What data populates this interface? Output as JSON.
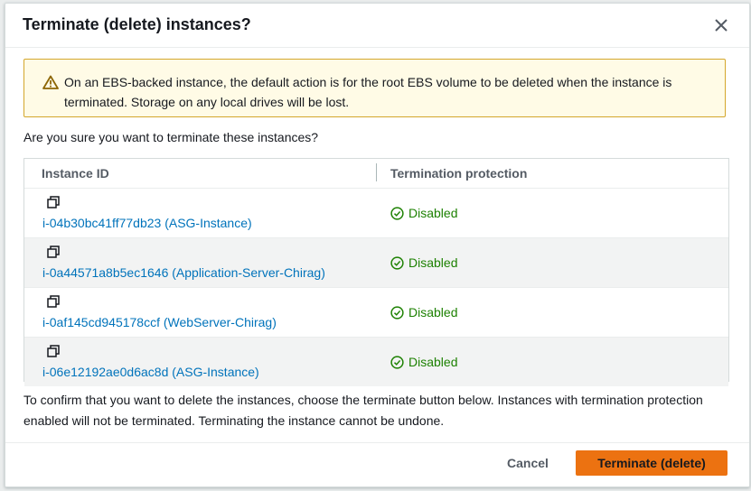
{
  "dialog": {
    "title": "Terminate (delete) instances?",
    "close_icon": "close-icon"
  },
  "warning": {
    "icon": "warning-icon",
    "text": "On an EBS-backed instance, the default action is for the root EBS volume to be deleted when the instance is terminated. Storage on any local drives will be lost."
  },
  "question": "Are you sure you want to terminate these instances?",
  "table": {
    "columns": [
      "Instance ID",
      "Termination protection"
    ],
    "rows": [
      {
        "instance": "i-04b30bc41ff77db23 (ASG-Instance)",
        "protection": "Disabled"
      },
      {
        "instance": "i-0a44571a8b5ec1646 (Application-Server-Chirag)",
        "protection": "Disabled"
      },
      {
        "instance": "i-0af145cd945178ccf (WebServer-Chirag)",
        "protection": "Disabled"
      },
      {
        "instance": "i-06e12192ae0d6ac8d (ASG-Instance)",
        "protection": "Disabled"
      }
    ]
  },
  "confirm_text": "To confirm that you want to delete the instances, choose the terminate button below. Instances with termination protection enabled will not be terminated. Terminating the instance cannot be undone.",
  "buttons": {
    "cancel": "Cancel",
    "terminate": "Terminate (delete)"
  },
  "colors": {
    "accent": "#ec7211",
    "link": "#0073bb",
    "success": "#1d8102",
    "warning_border": "#d4a72c"
  }
}
